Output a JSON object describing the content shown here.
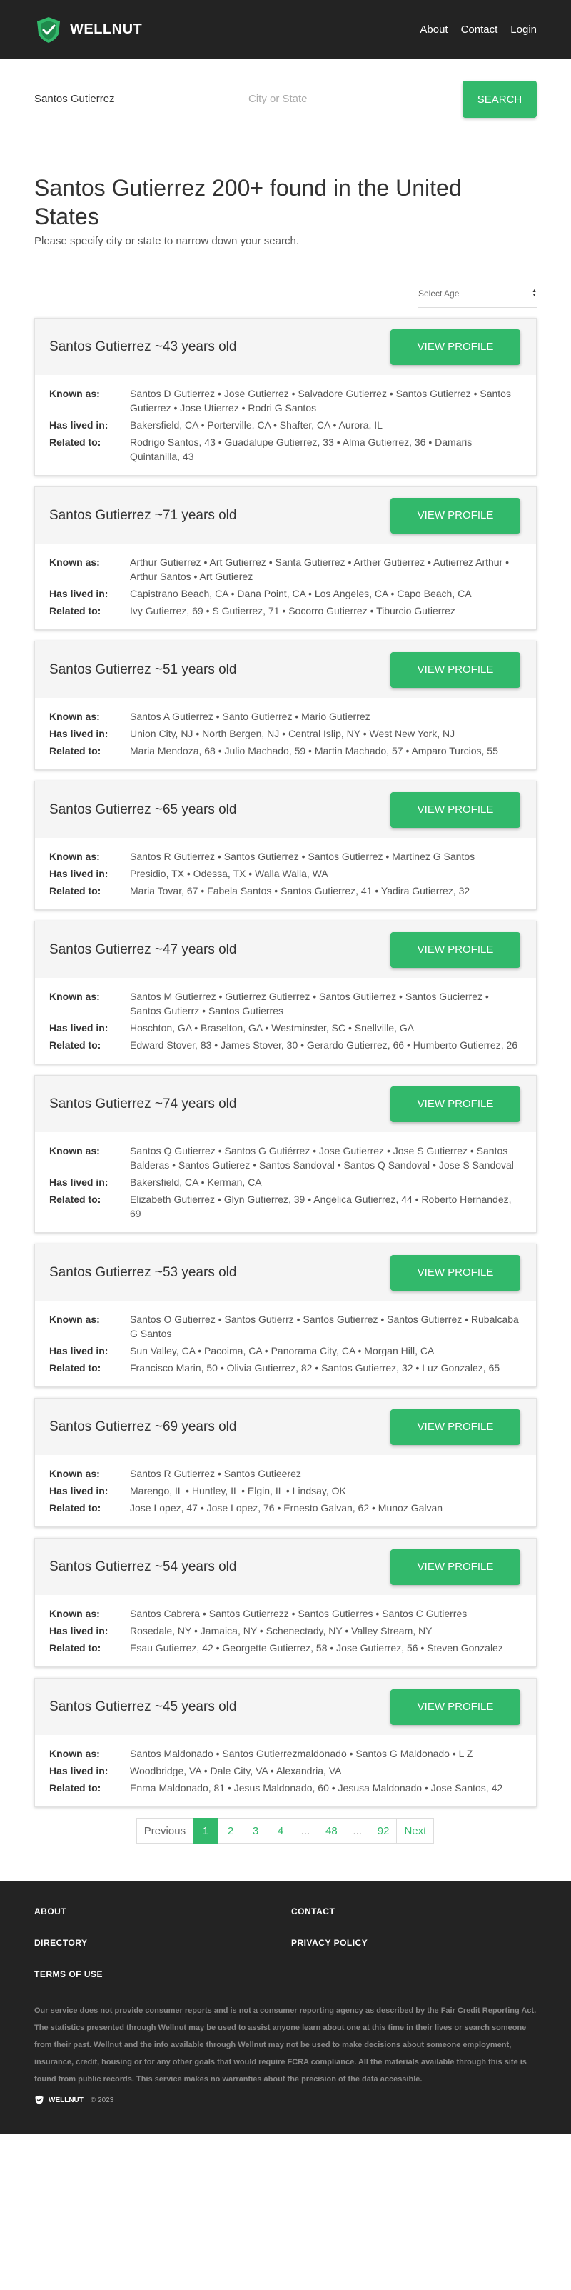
{
  "brand": {
    "name": "WELLNUT",
    "logo_icon": "shield-check-icon",
    "accent": "#32b96b"
  },
  "nav": [
    {
      "label": "About"
    },
    {
      "label": "Contact"
    },
    {
      "label": "Login"
    }
  ],
  "search": {
    "name_value": "Santos Gutierrez",
    "location_placeholder": "City or State",
    "button": "SEARCH"
  },
  "results_header": {
    "title": "Santos Gutierrez 200+ found in the United States",
    "subtitle": "Please specify city or state to narrow down your search.",
    "age_select": "Select Age"
  },
  "labels": {
    "known_as": "Known as:",
    "lived": "Has lived in:",
    "related": "Related to:",
    "view": "VIEW PROFILE"
  },
  "results": [
    {
      "name": "Santos Gutierrez ~43 years old",
      "known_as": "Santos D Gutierrez • Jose Gutierrez • Salvadore Gutierrez • Santos Gutierrez • Santos Gutierrez • Jose Utierrez • Rodri G Santos",
      "lived": "Bakersfield, CA • Porterville, CA • Shafter, CA • Aurora, IL",
      "related": "Rodrigo Santos, 43 • Guadalupe Gutierrez, 33 • Alma Gutierrez, 36 • Damaris Quintanilla, 43"
    },
    {
      "name": "Santos Gutierrez ~71 years old",
      "known_as": "Arthur Gutierrez • Art Gutierrez • Santa Gutierrez • Arther Gutierrez • Autierrez Arthur • Arthur Santos • Art Gutierez",
      "lived": "Capistrano Beach, CA • Dana Point, CA • Los Angeles, CA • Capo Beach, CA",
      "related": "Ivy Gutierrez, 69 • S Gutierrez, 71 • Socorro Gutierrez • Tiburcio Gutierrez"
    },
    {
      "name": "Santos Gutierrez ~51 years old",
      "known_as": "Santos A Gutierrez • Santo Gutierrez • Mario Gutierrez",
      "lived": "Union City, NJ • North Bergen, NJ • Central Islip, NY • West New York, NJ",
      "related": "Maria Mendoza, 68 • Julio Machado, 59 • Martin Machado, 57 • Amparo Turcios, 55"
    },
    {
      "name": "Santos Gutierrez ~65 years old",
      "known_as": "Santos R Gutierrez • Santos Gutierrez • Santos Gutierrez • Martinez G Santos",
      "lived": "Presidio, TX • Odessa, TX • Walla Walla, WA",
      "related": "Maria Tovar, 67 • Fabela Santos • Santos Gutierrez, 41 • Yadira Gutierrez, 32"
    },
    {
      "name": "Santos Gutierrez ~47 years old",
      "known_as": "Santos M Gutierrez • Gutierrez Gutierrez • Santos Gutiierrez • Santos Gucierrez • Santos Gutierrz • Santos Gutierres",
      "lived": "Hoschton, GA • Braselton, GA • Westminster, SC • Snellville, GA",
      "related": "Edward Stover, 83 • James Stover, 30 • Gerardo Gutierrez, 66 • Humberto Gutierrez, 26"
    },
    {
      "name": "Santos Gutierrez ~74 years old",
      "known_as": "Santos Q Gutierrez • Santos G Gutiérrez • Jose Gutierrez • Jose S Gutierrez • Santos Balderas • Santos Gutierez • Santos Sandoval • Santos Q Sandoval • Jose S Sandoval",
      "lived": "Bakersfield, CA • Kerman, CA",
      "related": "Elizabeth Gutierrez • Glyn Gutierrez, 39 • Angelica Gutierrez, 44 • Roberto Hernandez, 69"
    },
    {
      "name": "Santos Gutierrez ~53 years old",
      "known_as": "Santos O Gutierrez • Santos Gutierrz • Santos Gutierrez • Santos Gutierrez • Rubalcaba G Santos",
      "lived": "Sun Valley, CA • Pacoima, CA • Panorama City, CA • Morgan Hill, CA",
      "related": "Francisco Marin, 50 • Olivia Gutierrez, 82 • Santos Gutierrez, 32 • Luz Gonzalez, 65"
    },
    {
      "name": "Santos Gutierrez ~69 years old",
      "known_as": "Santos R Gutierrez • Santos Gutieerez",
      "lived": "Marengo, IL • Huntley, IL • Elgin, IL • Lindsay, OK",
      "related": "Jose Lopez, 47 • Jose Lopez, 76 • Ernesto Galvan, 62 • Munoz Galvan"
    },
    {
      "name": "Santos Gutierrez ~54 years old",
      "known_as": "Santos Cabrera • Santos Gutierrezz • Santos Gutierres • Santos C Gutierres",
      "lived": "Rosedale, NY • Jamaica, NY • Schenectady, NY • Valley Stream, NY",
      "related": "Esau Gutierrez, 42 • Georgette Gutierrez, 58 • Jose Gutierrez, 56 • Steven Gonzalez"
    },
    {
      "name": "Santos Gutierrez ~45 years old",
      "known_as": "Santos Maldonado • Santos Gutierrezmaldonado • Santos G Maldonado • L Z",
      "lived": "Woodbridge, VA • Dale City, VA • Alexandria, VA",
      "related": "Enma Maldonado, 81 • Jesus Maldonado, 60 • Jesusa Maldonado • Jose Santos, 42"
    }
  ],
  "pagination": {
    "previous": "Previous",
    "pages": [
      "1",
      "2",
      "3",
      "4",
      "...",
      "48",
      "...",
      "92"
    ],
    "current": "1",
    "next": "Next"
  },
  "footer": {
    "links": [
      "ABOUT",
      "CONTACT",
      "DIRECTORY",
      "PRIVACY POLICY",
      "TERMS OF USE"
    ],
    "disclaimer": "Our service does not provide consumer reports and is not a consumer reporting agency as described by the Fair Credit Reporting Act. The statistics presented through Wellnut may be used to assist anyone learn about one at this time in their lives or search someone from their past. Wellnut and the info available through Wellnut may not be used to make decisions about someone employment, insurance, credit, housing or for any other goals that would require FCRA compliance. All the materials available through this site is found from public records. This service makes no warranties about the precision of the data accessible.",
    "brand": "WELLNUT",
    "copyright": "© 2023"
  }
}
